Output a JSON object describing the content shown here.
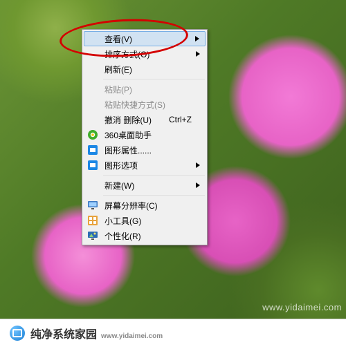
{
  "context_menu": {
    "items": [
      {
        "label": "查看(V)",
        "has_submenu": true,
        "highlighted": true
      },
      {
        "label": "排序方式(O)",
        "has_submenu": true
      },
      {
        "label": "刷新(E)"
      },
      {
        "separator": true
      },
      {
        "label": "粘贴(P)",
        "disabled": true
      },
      {
        "label": "粘贴快捷方式(S)",
        "disabled": true
      },
      {
        "label": "撤消 删除(U)",
        "shortcut": "Ctrl+Z"
      },
      {
        "label": "360桌面助手",
        "icon": "360-icon"
      },
      {
        "label": "图形属性......",
        "icon": "intel-graphics-icon"
      },
      {
        "label": "图形选项",
        "icon": "intel-graphics-icon",
        "has_submenu": true
      },
      {
        "separator": true
      },
      {
        "label": "新建(W)",
        "has_submenu": true
      },
      {
        "separator": true
      },
      {
        "label": "屏幕分辨率(C)",
        "icon": "monitor-icon"
      },
      {
        "label": "小工具(G)",
        "icon": "gadgets-icon"
      },
      {
        "label": "个性化(R)",
        "icon": "personalize-icon"
      }
    ]
  },
  "watermark": {
    "bottom_right": "www.yidaimei.com"
  },
  "footer": {
    "brand": "纯净系统家园",
    "sub": "www.yidaimei.com"
  }
}
